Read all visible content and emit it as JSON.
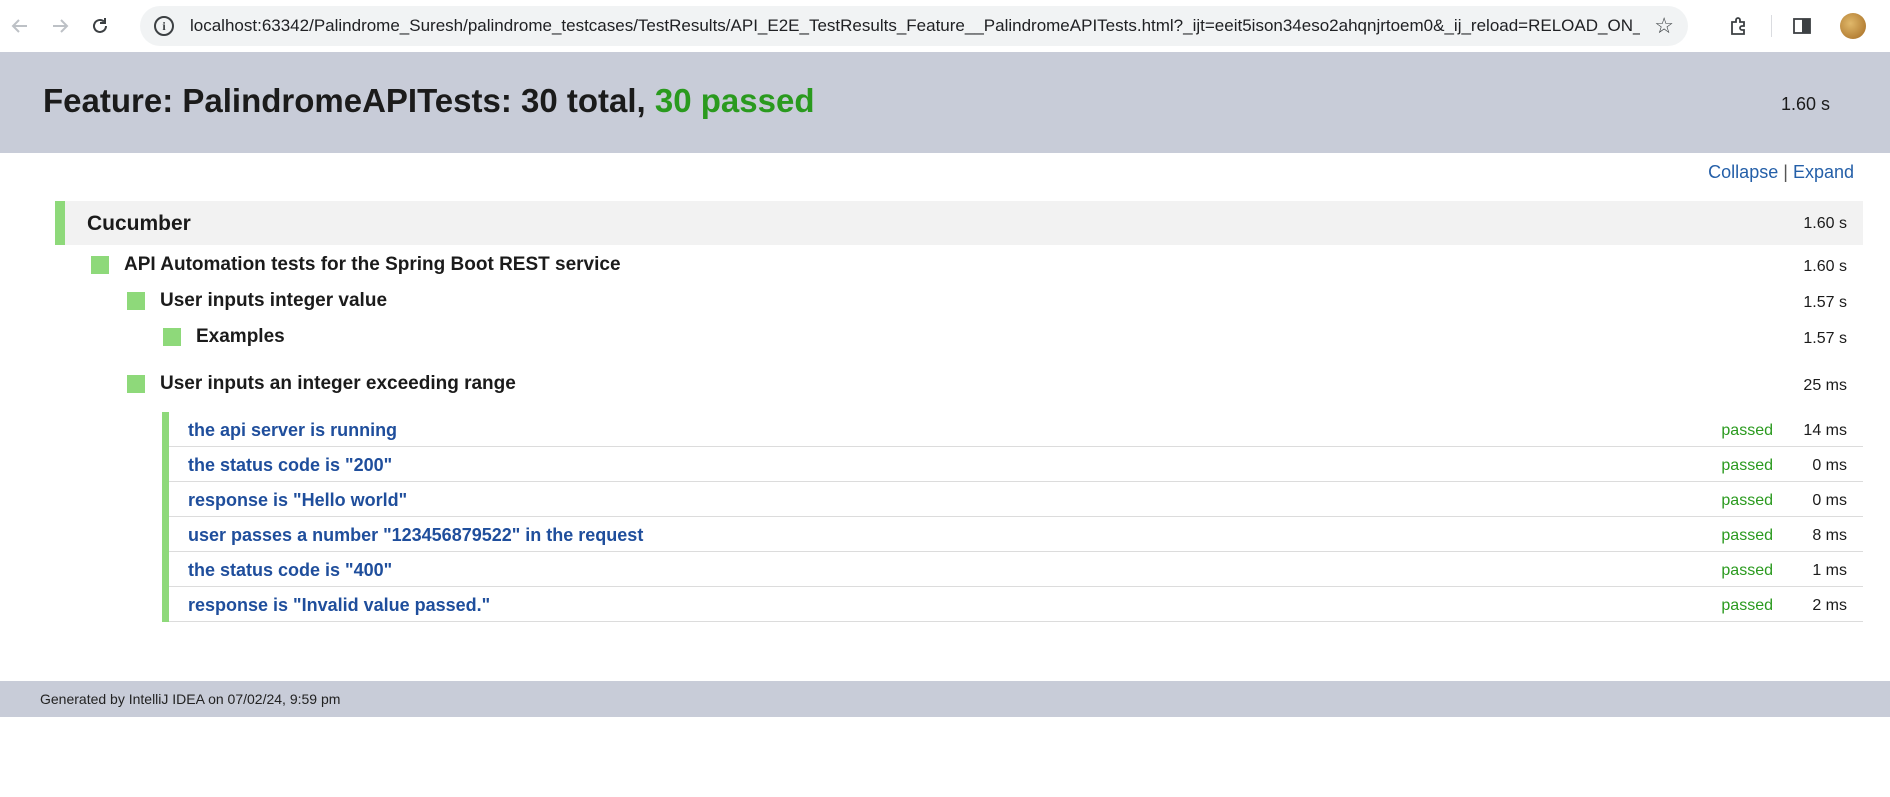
{
  "browser": {
    "url": "localhost:63342/Palindrome_Suresh/palindrome_testcases/TestResults/API_E2E_TestResults_Feature__PalindromeAPITests.html?_ijt=eeit5ison34eso2ahqnjrtoem0&_ij_reload=RELOAD_ON_S...",
    "icons": [
      "back-icon",
      "forward-icon",
      "reload-icon",
      "site-info-icon",
      "bookmark-star-icon",
      "extensions-icon",
      "side-panel-icon",
      "profile-avatar"
    ]
  },
  "header": {
    "title_prefix": "Feature: PalindromeAPITests: 30 total, ",
    "title_passed": "30 passed",
    "duration": "1.60 s"
  },
  "controls": {
    "collapse": "Collapse",
    "separator": "|",
    "expand": "Expand"
  },
  "tree": {
    "suite": {
      "name": "Cucumber",
      "duration": "1.60 s"
    },
    "feature": {
      "name": "API Automation tests for the Spring Boot REST service",
      "duration": "1.60 s"
    },
    "scenario1": {
      "name": "User inputs integer value",
      "duration": "1.57 s"
    },
    "examples": {
      "name": "Examples",
      "duration": "1.57 s"
    },
    "scenario2": {
      "name": "User inputs an integer exceeding range",
      "duration": "25 ms"
    },
    "steps": [
      {
        "name": "the api server is running",
        "status": "passed",
        "duration": "14 ms"
      },
      {
        "name": "the status code is \"200\"",
        "status": "passed",
        "duration": "0 ms"
      },
      {
        "name": "response is \"Hello world\"",
        "status": "passed",
        "duration": "0 ms"
      },
      {
        "name": "user passes a number \"123456879522\" in the request",
        "status": "passed",
        "duration": "8 ms"
      },
      {
        "name": "the status code is \"400\"",
        "status": "passed",
        "duration": "1 ms"
      },
      {
        "name": "response is \"Invalid value passed.\"",
        "status": "passed",
        "duration": "2 ms"
      }
    ]
  },
  "footer": {
    "text": "Generated by IntelliJ IDEA on 07/02/24, 9:59 pm"
  },
  "colors": {
    "passed": "#2a9a1e",
    "status_bar": "#8ed97a",
    "header_bg": "#c8ccd8",
    "link": "#1f4e9c"
  }
}
